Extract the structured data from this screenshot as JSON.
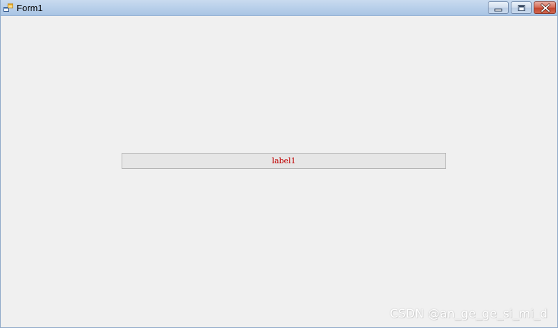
{
  "window": {
    "title": "Form1",
    "icon": "app-form-icon",
    "buttons": {
      "minimize": "minimize-icon",
      "maximize": "maximize-icon",
      "close": "close-icon"
    }
  },
  "form": {
    "label1_text": "label1"
  },
  "watermark": {
    "text": "CSDN @an_ge_ge_si_mi_d"
  },
  "colors": {
    "label_text": "#c00000",
    "label_background": "#e6e6e6",
    "client_background": "#f0f0f0"
  }
}
